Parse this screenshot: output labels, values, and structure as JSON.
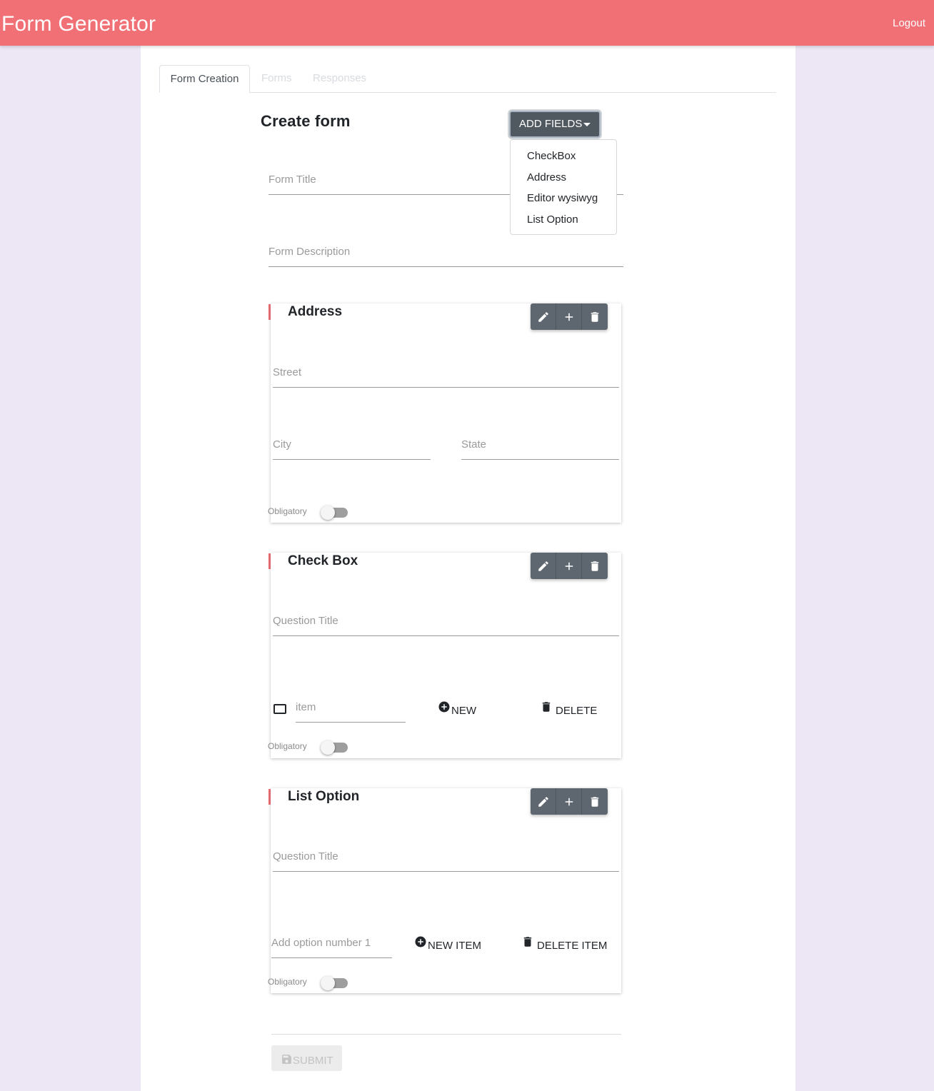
{
  "navbar": {
    "brand": "Form Generator",
    "logout": "Logout"
  },
  "tabs": [
    {
      "label": "Form Creation",
      "active": true
    },
    {
      "label": "Forms",
      "active": false
    },
    {
      "label": "Responses",
      "active": false
    }
  ],
  "create_form": {
    "title": "Create form",
    "add_fields_label": "ADD FIELDS",
    "dropdown_items": [
      "CheckBox",
      "Address",
      "Editor wysiwyg",
      "List Option"
    ],
    "form_title_placeholder": "Form Title",
    "form_description_placeholder": "Form Description"
  },
  "cards": {
    "address": {
      "title": "Address",
      "street_placeholder": "Street",
      "city_placeholder": "City",
      "state_placeholder": "State",
      "obligatory_label": "Obligatory",
      "obligatory_on": false
    },
    "checkbox": {
      "title": "Check Box",
      "question_placeholder": "Question Title",
      "item_placeholder": "item",
      "new_label": "NEW",
      "delete_label": "DELETE",
      "obligatory_label": "Obligatory",
      "obligatory_on": false
    },
    "list_option": {
      "title": "List Option",
      "question_placeholder": "Question Title",
      "option_placeholder": "Add option number 1",
      "new_item_label": "NEW ITEM",
      "delete_item_label": "DELETE ITEM",
      "obligatory_label": "Obligatory",
      "obligatory_on": false
    }
  },
  "submit_label": "SUBMIT",
  "icons": [
    "pencil-icon",
    "plus-icon",
    "trash-icon",
    "plus-circle-icon",
    "save-icon",
    "square-outline-icon",
    "caret-down-icon"
  ],
  "colors": {
    "primary": "#f07075",
    "background": "#ede6f4",
    "button_dark": "#5e6770"
  }
}
